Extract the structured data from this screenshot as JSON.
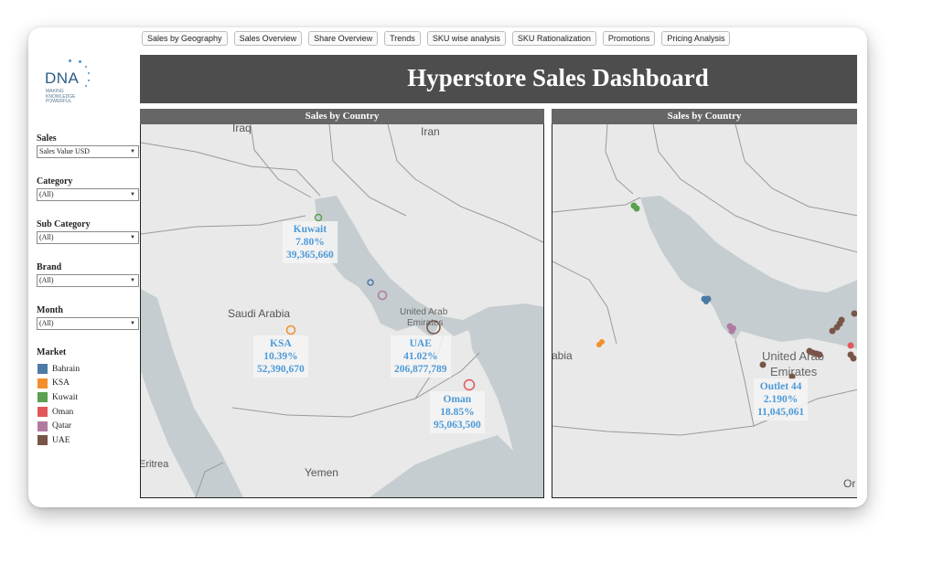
{
  "nav": {
    "tabs": [
      "Sales by Geography",
      "Sales Overview",
      "Share Overview",
      "Trends",
      "SKU wise analysis",
      "SKU Rationalization",
      "Promotions",
      "Pricing Analysis"
    ]
  },
  "logo": {
    "text": "DNA",
    "tagline_1": "MAKING",
    "tagline_2": "KNOWLEDGE",
    "tagline_3": "POWERFUL"
  },
  "title": "Hyperstore Sales Dashboard",
  "filters": [
    {
      "label": "Sales",
      "value": "Sales Value USD"
    },
    {
      "label": "Category",
      "value": "(All)"
    },
    {
      "label": "Sub Category",
      "value": "(All)"
    },
    {
      "label": "Brand",
      "value": "(All)"
    },
    {
      "label": "Month",
      "value": "(All)"
    }
  ],
  "market": {
    "title": "Market",
    "items": [
      {
        "label": "Bahrain",
        "color": "#4e79a7"
      },
      {
        "label": "KSA",
        "color": "#f28e2b"
      },
      {
        "label": "Kuwait",
        "color": "#59a14f"
      },
      {
        "label": "Oman",
        "color": "#e15759"
      },
      {
        "label": "Qatar",
        "color": "#b07aa1"
      },
      {
        "label": "UAE",
        "color": "#795548"
      }
    ]
  },
  "panels": {
    "left": {
      "header": "Sales by Country",
      "places": {
        "iraq": "Iraq",
        "iran": "Iran",
        "saudi": "Saudi Arabia",
        "uae": "United Arab",
        "uae2": "Emirates",
        "eritrea": "Eritrea",
        "yemen": "Yemen"
      },
      "tooltips": [
        {
          "name": "Kuwait",
          "share": "7.80%",
          "value": "39,365,660"
        },
        {
          "name": "KSA",
          "share": "10.39%",
          "value": "52,390,670"
        },
        {
          "name": "UAE",
          "share": "41.02%",
          "value": "206,877,789"
        },
        {
          "name": "Oman",
          "share": "18.85%",
          "value": "95,063,500"
        }
      ]
    },
    "right": {
      "header": "Sales by Country",
      "places": {
        "abia": "abia",
        "uae": "United Arab",
        "uae2": "Emirates",
        "or": "Or"
      },
      "tooltip": {
        "name": "Outlet 44",
        "share": "2.190%",
        "value": "11,045,061"
      }
    }
  }
}
